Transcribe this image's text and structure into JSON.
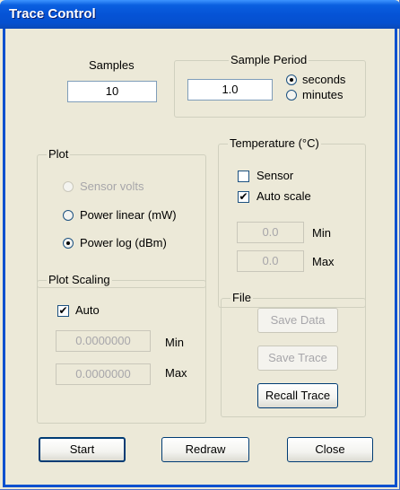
{
  "window": {
    "title": "Trace Control"
  },
  "samples": {
    "label": "Samples",
    "value": "10"
  },
  "sample_period": {
    "legend": "Sample Period",
    "value": "1.0",
    "options": [
      {
        "label": "seconds",
        "selected": true
      },
      {
        "label": "minutes",
        "selected": false
      }
    ]
  },
  "plot": {
    "legend": "Plot",
    "options": [
      {
        "label": "Sensor volts",
        "selected": false,
        "enabled": false
      },
      {
        "label": "Power linear (mW)",
        "selected": false,
        "enabled": true
      },
      {
        "label": "Power log (dBm)",
        "selected": true,
        "enabled": true
      }
    ]
  },
  "temperature": {
    "legend": "Temperature (°C)",
    "sensor": {
      "label": "Sensor",
      "checked": false
    },
    "auto_scale": {
      "label": "Auto scale",
      "checked": true
    },
    "min": {
      "label": "Min",
      "value": "0.0"
    },
    "max": {
      "label": "Max",
      "value": "0.0"
    }
  },
  "plot_scaling": {
    "legend": "Plot Scaling",
    "auto": {
      "label": "Auto",
      "checked": true
    },
    "min": {
      "label": "Min",
      "value": "0.0000000"
    },
    "max": {
      "label": "Max",
      "value": "0.0000000"
    }
  },
  "file": {
    "legend": "File",
    "save_data": "Save Data",
    "save_trace": "Save Trace",
    "recall_trace": "Recall Trace"
  },
  "buttons": {
    "start": "Start",
    "redraw": "Redraw",
    "close": "Close"
  },
  "check_glyph": "✔"
}
